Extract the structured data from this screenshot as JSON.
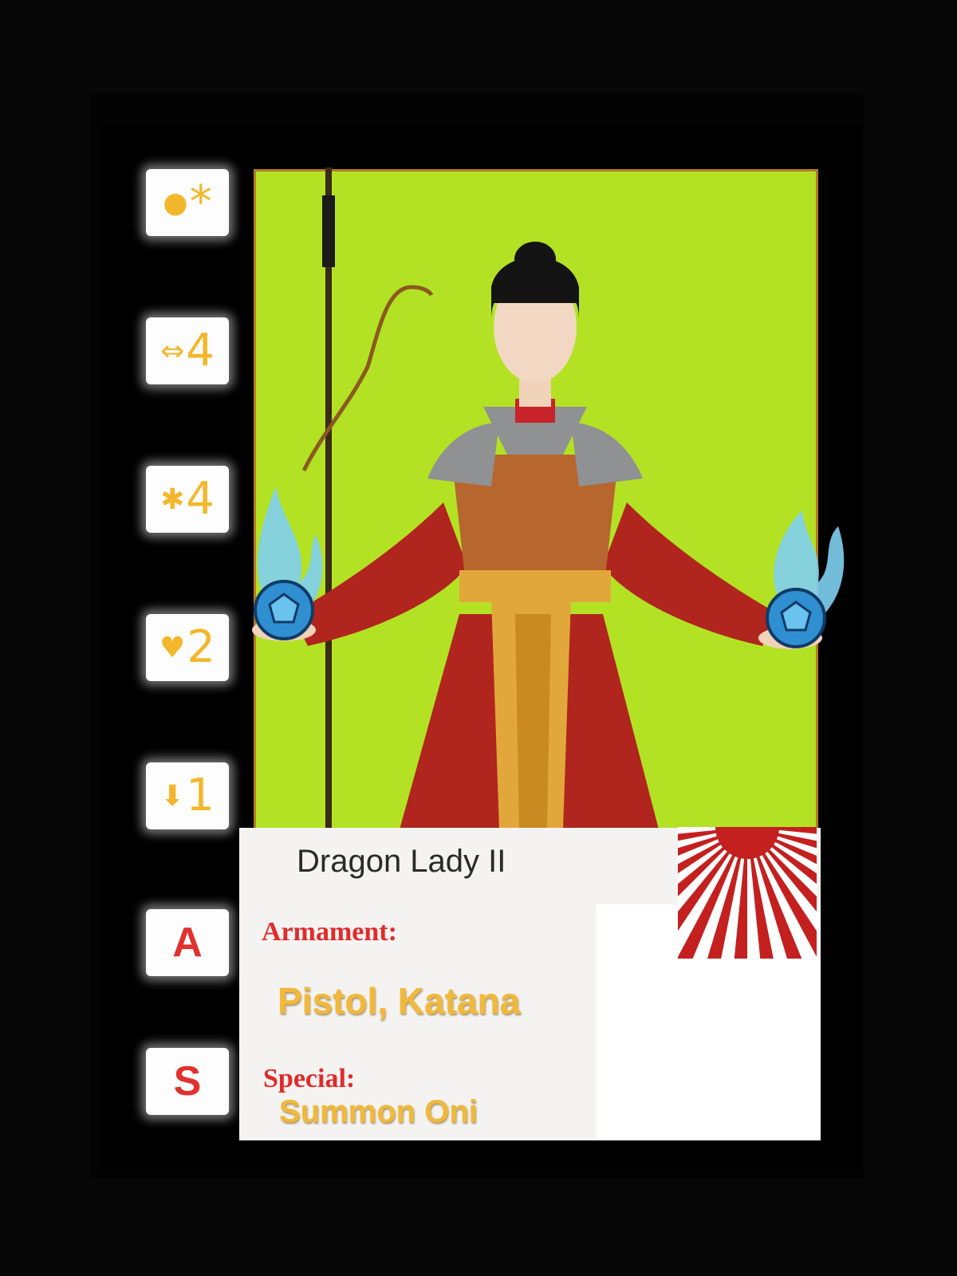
{
  "card": {
    "name": "Dragon Lady II",
    "armament_label": "Armament:",
    "armament_value": "Pistol, Katana",
    "special_label": "Special:",
    "special_value": "Summon Oni"
  },
  "stats": [
    {
      "icon": "coin-icon",
      "glyph": "●",
      "value": "*"
    },
    {
      "icon": "move-arrows-icon",
      "glyph": "⇔",
      "value": "4"
    },
    {
      "icon": "burst-icon",
      "glyph": "✱",
      "value": "4"
    },
    {
      "icon": "heart-icon",
      "glyph": "♥",
      "value": "2"
    },
    {
      "icon": "down-arrow-icon",
      "glyph": "⬇",
      "value": "1"
    }
  ],
  "letters": {
    "armament": "A",
    "special": "S"
  },
  "colors": {
    "art_background": "#b3e224",
    "stat_text": "#f3b72c",
    "label_red": "#e02b2a",
    "card_black": "#000000"
  }
}
